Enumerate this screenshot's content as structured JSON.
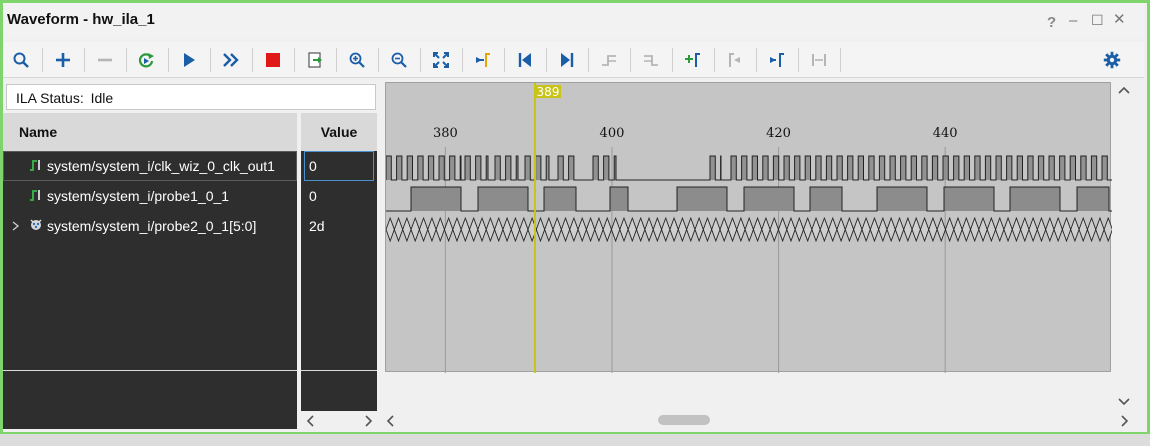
{
  "window": {
    "title": "Waveform - hw_ila_1",
    "help_label": "?",
    "minimize_label": "–",
    "maximize_label": "☐",
    "close_label": "✕"
  },
  "toolbar": {
    "buttons": [
      "search-icon",
      "add-icon",
      "remove-icon",
      "refresh-icon",
      "run-trigger-icon",
      "run-immediate-icon",
      "stop-icon",
      "export-icon",
      "zoom-in-icon",
      "zoom-out-icon",
      "zoom-fit-icon",
      "go-to-cursor-icon",
      "go-to-start-icon",
      "go-to-end-icon",
      "previous-transition-icon",
      "next-transition-icon",
      "add-marker-icon",
      "previous-marker-icon",
      "next-marker-icon",
      "swap-cursors-icon",
      "settings-icon"
    ]
  },
  "ila_status": {
    "label": "ILA Status:",
    "value": "Idle"
  },
  "columns": {
    "name": "Name",
    "value": "Value"
  },
  "signals": [
    {
      "name": "system/system_i/clk_wiz_0_clk_out1",
      "value": "0",
      "type": "bit"
    },
    {
      "name": "system/system_i/probe1_0_1",
      "value": "0",
      "type": "bit"
    },
    {
      "name": "system/system_i/probe2_0_1[5:0]",
      "value": "2d",
      "type": "bus"
    }
  ],
  "timeline": {
    "marker_label": "389",
    "ticks": [
      "380",
      "400",
      "420",
      "440"
    ]
  },
  "colors": {
    "marker": "#c8c41a",
    "signal_fill": "#8c8c8c",
    "frame_accent": "#7fd46b"
  }
}
